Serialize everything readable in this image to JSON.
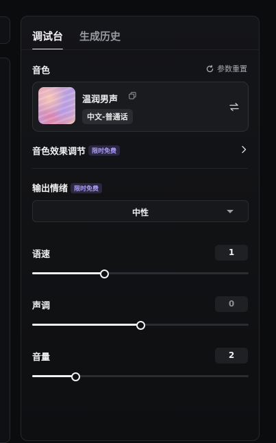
{
  "tabs": [
    {
      "label": "调试台",
      "active": true
    },
    {
      "label": "生成历史",
      "active": false
    }
  ],
  "timbre": {
    "label": "音色",
    "reset_label": "参数重置",
    "voice_name": "温润男声",
    "voice_language": "中文-普通话"
  },
  "effect": {
    "label": "音色效果调节",
    "badge": "限时免费"
  },
  "emotion": {
    "label": "输出情绪",
    "badge": "限时免费",
    "selected": "中性"
  },
  "sliders": {
    "speed": {
      "label": "语速",
      "value": "1",
      "fraction": 0.333
    },
    "pitch": {
      "label": "声调",
      "value": "0",
      "fraction": 0.5
    },
    "volume": {
      "label": "音量",
      "value": "2",
      "fraction": 0.2
    }
  },
  "colors": {
    "accent": "#f2f2f4",
    "badge_text": "#a99af0",
    "badge_bg": "#2b2740",
    "background": "#0b0c0e"
  },
  "icons": {
    "reset": "refresh-icon",
    "copy": "copy-icon",
    "swap": "swap-icon",
    "chevron": "chevron-right-icon",
    "caret": "caret-down-icon"
  }
}
